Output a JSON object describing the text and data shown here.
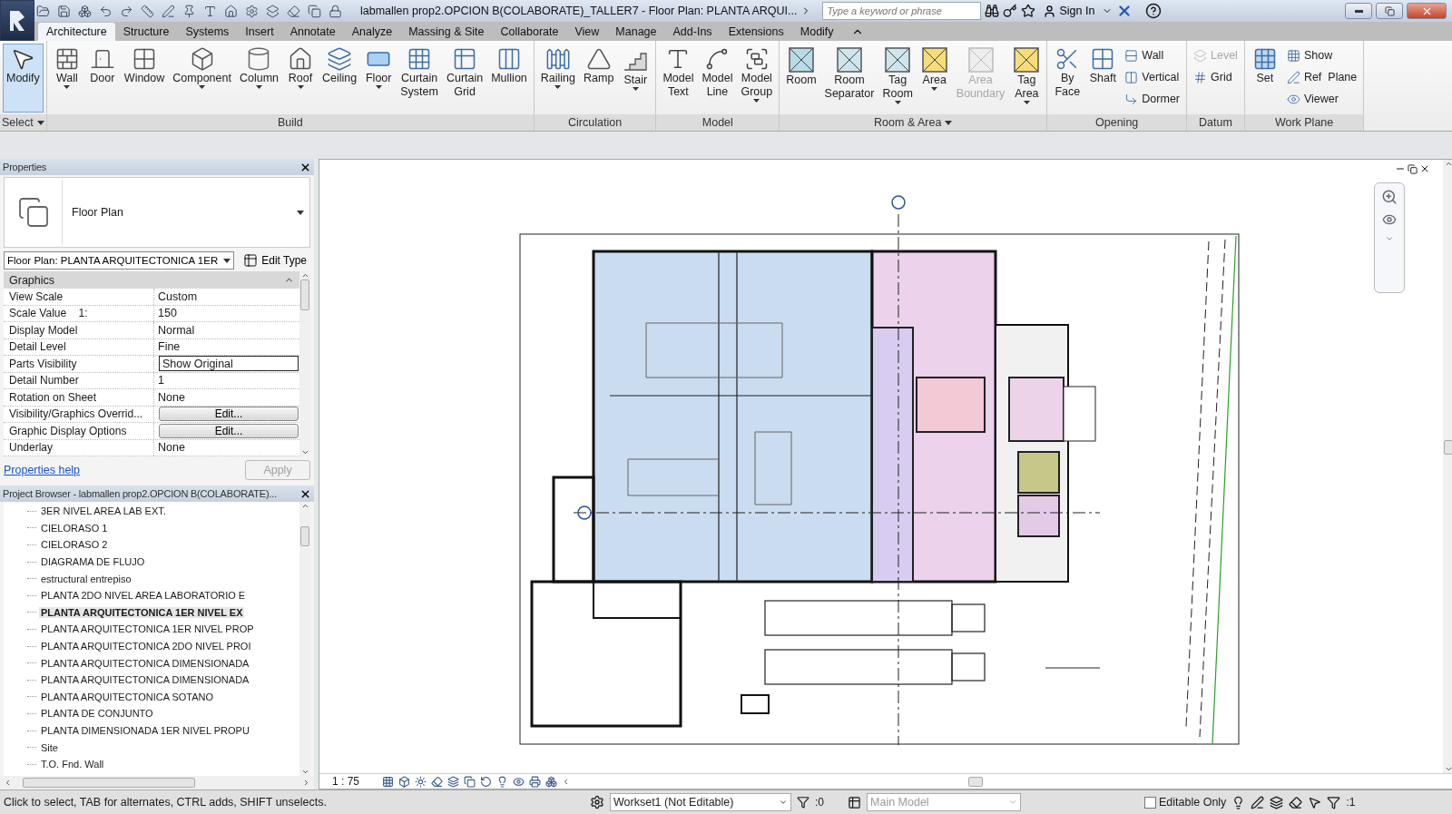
{
  "title_bar": {
    "title": "labmallen prop2.OPCION B(COLABORATE)_TALLER7 - Floor Plan: PLANTA ARQUI...",
    "search": {
      "placeholder": "Type a keyword or phrase"
    },
    "sign_in": "Sign In"
  },
  "tabs": [
    {
      "label": "Architecture",
      "selected": true
    },
    {
      "label": "Structure",
      "selected": false
    },
    {
      "label": "Systems",
      "selected": false
    },
    {
      "label": "Insert",
      "selected": false
    },
    {
      "label": "Annotate",
      "selected": false
    },
    {
      "label": "Analyze",
      "selected": false
    },
    {
      "label": "Massing & Site",
      "selected": false
    },
    {
      "label": "Collaborate",
      "selected": false
    },
    {
      "label": "View",
      "selected": false
    },
    {
      "label": "Manage",
      "selected": false
    },
    {
      "label": "Add-Ins",
      "selected": false
    },
    {
      "label": "Extensions",
      "selected": false
    },
    {
      "label": "Modify",
      "selected": false
    }
  ],
  "ribbon": [
    {
      "label": "Select",
      "caret": true,
      "buttons": [
        {
          "kind": "large",
          "label": "Modify",
          "selected": true,
          "disabled": false,
          "caret": false
        }
      ]
    },
    {
      "label": "Build",
      "caret": false,
      "buttons": [
        {
          "kind": "large",
          "label": "Wall",
          "selected": false,
          "disabled": false,
          "caret": true
        },
        {
          "kind": "large",
          "label": "Door",
          "selected": false,
          "disabled": false,
          "caret": false
        },
        {
          "kind": "large",
          "label": "Window",
          "selected": false,
          "disabled": false,
          "caret": false
        },
        {
          "kind": "large",
          "label": "Component",
          "selected": false,
          "disabled": false,
          "caret": true
        },
        {
          "kind": "large",
          "label": "Column",
          "selected": false,
          "disabled": false,
          "caret": true
        },
        {
          "kind": "large",
          "label": "Roof",
          "selected": false,
          "disabled": false,
          "caret": true
        },
        {
          "kind": "large",
          "label": "Ceiling",
          "selected": false,
          "disabled": false,
          "caret": false
        },
        {
          "kind": "large",
          "label": "Floor",
          "selected": false,
          "disabled": false,
          "caret": true
        },
        {
          "kind": "large",
          "label": "Curtain\nSystem",
          "selected": false,
          "disabled": false,
          "caret": false
        },
        {
          "kind": "large",
          "label": "Curtain\nGrid",
          "selected": false,
          "disabled": false,
          "caret": false
        },
        {
          "kind": "large",
          "label": "Mullion",
          "selected": false,
          "disabled": false,
          "caret": false
        }
      ]
    },
    {
      "label": "Circulation",
      "caret": false,
      "buttons": [
        {
          "kind": "large",
          "label": "Railing",
          "selected": false,
          "disabled": false,
          "caret": true
        },
        {
          "kind": "large",
          "label": "Ramp",
          "selected": false,
          "disabled": false,
          "caret": false
        },
        {
          "kind": "large",
          "label": "Stair",
          "selected": false,
          "disabled": false,
          "caret": true
        }
      ]
    },
    {
      "label": "Model",
      "caret": false,
      "buttons": [
        {
          "kind": "large",
          "label": "Model\nText",
          "selected": false,
          "disabled": false,
          "caret": false
        },
        {
          "kind": "large",
          "label": "Model\nLine",
          "selected": false,
          "disabled": false,
          "caret": false
        },
        {
          "kind": "large",
          "label": "Model\nGroup",
          "selected": false,
          "disabled": false,
          "caret": true
        }
      ]
    },
    {
      "label": "Room & Area",
      "caret": true,
      "buttons": [
        {
          "kind": "large",
          "label": "Room",
          "selected": false,
          "disabled": false,
          "caret": false
        },
        {
          "kind": "large",
          "label": "Room\nSeparator",
          "selected": false,
          "disabled": false,
          "caret": false
        },
        {
          "kind": "large",
          "label": "Tag\nRoom",
          "selected": false,
          "disabled": false,
          "caret": true
        },
        {
          "kind": "large",
          "label": "Area",
          "selected": false,
          "disabled": false,
          "caret": true
        },
        {
          "kind": "large",
          "label": "Area\nBoundary",
          "selected": false,
          "disabled": true,
          "caret": false
        },
        {
          "kind": "large",
          "label": "Tag\nArea",
          "selected": false,
          "disabled": false,
          "caret": true
        }
      ]
    },
    {
      "label": "Opening",
      "caret": false,
      "buttons": [
        {
          "kind": "large",
          "label": "By\nFace",
          "selected": false,
          "disabled": false,
          "caret": false
        },
        {
          "kind": "large",
          "label": "Shaft",
          "selected": false,
          "disabled": false,
          "caret": false
        },
        {
          "kind": "small",
          "label": "Wall",
          "selected": false,
          "disabled": false,
          "caret": false
        },
        {
          "kind": "small",
          "label": "Vertical",
          "selected": false,
          "disabled": false,
          "caret": false
        },
        {
          "kind": "small",
          "label": "Dormer",
          "selected": false,
          "disabled": false,
          "caret": false
        }
      ]
    },
    {
      "label": "Datum",
      "caret": false,
      "buttons": [
        {
          "kind": "small",
          "label": "Level",
          "selected": false,
          "disabled": true,
          "caret": false
        },
        {
          "kind": "small",
          "label": "Grid",
          "selected": false,
          "disabled": false,
          "caret": false
        }
      ]
    },
    {
      "label": "Work Plane",
      "caret": false,
      "buttons": [
        {
          "kind": "large",
          "label": "Set",
          "selected": false,
          "disabled": false,
          "caret": false
        },
        {
          "kind": "small",
          "label": "Show",
          "selected": false,
          "disabled": false,
          "caret": false
        },
        {
          "kind": "small",
          "label": "Ref  Plane",
          "selected": false,
          "disabled": false,
          "caret": false
        },
        {
          "kind": "small",
          "label": "Viewer",
          "selected": false,
          "disabled": false,
          "caret": false
        }
      ]
    }
  ],
  "properties": {
    "title": "Properties",
    "type_name": "Floor Plan",
    "instance": "Floor Plan: PLANTA ARQUITECTONICA 1ER",
    "edit_type": "Edit Type",
    "section": "Graphics",
    "rows": [
      {
        "kind": "text",
        "name": "View Scale",
        "value": "Custom"
      },
      {
        "kind": "text",
        "name": "Scale Value    1:",
        "value": "150"
      },
      {
        "kind": "text",
        "name": "Display Model",
        "value": "Normal"
      },
      {
        "kind": "text",
        "name": "Detail Level",
        "value": "Fine"
      },
      {
        "kind": "field",
        "name": "Parts Visibility",
        "value": "Show Original"
      },
      {
        "kind": "text",
        "name": "Detail Number",
        "value": "1"
      },
      {
        "kind": "text",
        "name": "Rotation on Sheet",
        "value": "None"
      },
      {
        "kind": "button",
        "name": "Visibility/Graphics Overrid...",
        "value": "Edit..."
      },
      {
        "kind": "button",
        "name": "Graphic Display Options",
        "value": "Edit..."
      },
      {
        "kind": "text",
        "name": "Underlay",
        "value": "None"
      }
    ],
    "help": "Properties help",
    "apply": {
      "label": "Apply",
      "disabled": true
    }
  },
  "project_browser": {
    "title": "Project Browser - labmallen prop2.OPCION B(COLABORATE)...",
    "items": [
      {
        "label": "3ER NIVEL AREA LAB EXT.",
        "selected": false
      },
      {
        "label": "CIELORASO 1",
        "selected": false
      },
      {
        "label": "CIELORASO 2",
        "selected": false
      },
      {
        "label": "DIAGRAMA DE FLUJO",
        "selected": false
      },
      {
        "label": "estructural entrepiso",
        "selected": false
      },
      {
        "label": "PLANTA 2DO NIVEL AREA LABORATORIO  E",
        "selected": false
      },
      {
        "label": "PLANTA ARQUITECTONICA 1ER NIVEL EX",
        "selected": true
      },
      {
        "label": "PLANTA ARQUITECTONICA 1ER NIVEL PROP",
        "selected": false
      },
      {
        "label": "PLANTA ARQUITECTONICA 2DO NIVEL PROI",
        "selected": false
      },
      {
        "label": "PLANTA ARQUITECTONICA DIMENSIONADA",
        "selected": false
      },
      {
        "label": "PLANTA ARQUITECTONICA DIMENSIONADA",
        "selected": false
      },
      {
        "label": "PLANTA ARQUITECTONICA SOTANO",
        "selected": false
      },
      {
        "label": "PLANTA DE CONJUNTO",
        "selected": false
      },
      {
        "label": "PLANTA DIMENSIONADA 1ER NIVEL PROPU",
        "selected": false
      },
      {
        "label": "Site",
        "selected": false
      },
      {
        "label": "T.O. Fnd. Wall",
        "selected": false
      }
    ]
  },
  "view": {
    "scale": "1 : 75"
  },
  "status_bar": {
    "message": "Click to select, TAB for alternates, CTRL adds, SHIFT unselects.",
    "workset": "Workset1 (Not Editable)",
    "worksets_count": ":0",
    "design_option": {
      "value": "Main Model",
      "disabled": true
    },
    "editable_only": {
      "label": "Editable Only",
      "checked": false
    },
    "filter_count": ":1"
  }
}
